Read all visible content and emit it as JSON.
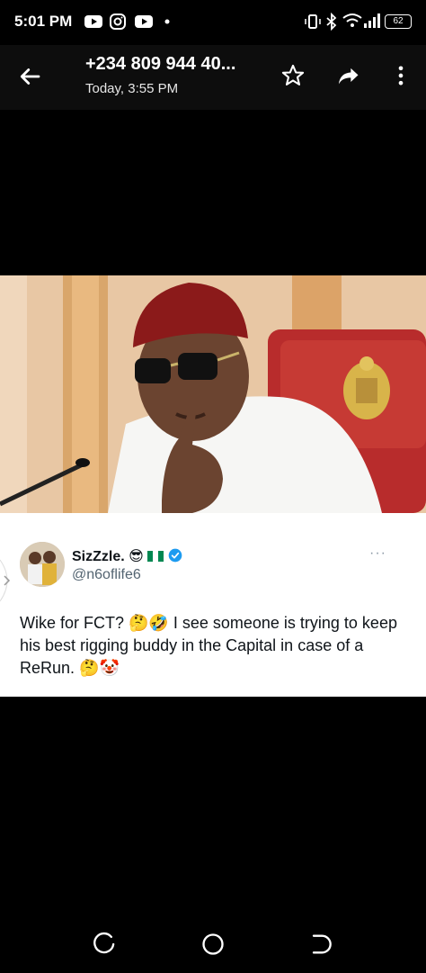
{
  "status": {
    "time": "5:01 PM",
    "battery": "62"
  },
  "header": {
    "title": "+234 809 944 40...",
    "subtitle": "Today, 3:55 PM"
  },
  "tweet": {
    "name": "SizZzle.",
    "name_emoji": "😎",
    "handle": "@n6oflife6",
    "more": "···",
    "text": "Wike for FCT? 🤔🤣 I see someone is trying to keep his best rigging buddy in the Capital in case of a ReRun. 🤔🤡"
  },
  "colors": {
    "verified": "#1d9bf0",
    "cap": "#8b1a1a",
    "chair": "#b82c2c",
    "flag_green": "#008751"
  },
  "icons": [
    "youtube-icon",
    "instagram-icon",
    "youtube-icon",
    "vibrate-icon",
    "bluetooth-icon",
    "wifi-icon",
    "signal-icon",
    "battery-icon",
    "back-arrow-icon",
    "star-icon",
    "share-icon",
    "more-vert-icon",
    "verified-badge-icon",
    "recents-icon",
    "home-icon",
    "back-icon"
  ]
}
